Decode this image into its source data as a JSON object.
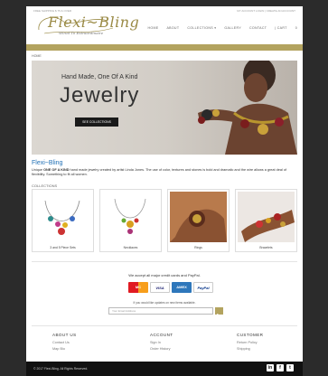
{
  "header": {
    "phone": "FREE SHIPPING $ 75 & OVER",
    "account_links": "MY ACCOUNT    LOGIN  |  CREATE AN ACCOUNT",
    "brand": "Flexi~Bling",
    "tagline": "Wired To Extraordinaire",
    "nav": [
      "HOME",
      "ABOUT",
      "COLLECTIONS ▾",
      "GALLERY",
      "CONTACT",
      "|  CART",
      "0"
    ]
  },
  "breadcrumb": "HOME",
  "hero": {
    "subtitle": "Hand Made, One Of A Kind",
    "title": "Jewelry",
    "button": "SEE COLLECTIONS"
  },
  "intro": {
    "title": "Flexi~Bling",
    "text_bold": "ONE OF A KIND",
    "text_pre": "Unique ",
    "text_post": " hand made jewelry created by artist Linda Jones. The use of color, textures and stones is bold and dramatic and the wire allows a great deal of flexibility. Something to fit all women."
  },
  "collections": {
    "label": "COLLECTIONS",
    "items": [
      "3 and 5 Piece Sets",
      "Necklaces",
      "Rings",
      "Bracelets"
    ]
  },
  "payment": {
    "text": "We accept all major credit cards and PayPal.",
    "cards": [
      "MC",
      "VISA",
      "AMEX",
      "PayPal"
    ]
  },
  "newsletter": {
    "text": "If you would like updates on new items available.",
    "placeholder": "Your Email Address"
  },
  "footer": {
    "columns": [
      {
        "title": "ABOUT US",
        "links": [
          "Contact Us",
          "Map Bio"
        ]
      },
      {
        "title": "ACCOUNT",
        "links": [
          "Sign In",
          "Order History"
        ]
      },
      {
        "title": "CUSTOMER",
        "links": [
          "Return Policy",
          "Shipping"
        ]
      }
    ],
    "copyright": "© 2017 Flexi-Bling. All Rights Reserved.",
    "social": [
      "in",
      "f",
      "t"
    ]
  },
  "colors": {
    "accent": "#b3a35f",
    "link": "#1f6fb5",
    "footer_bg": "#111111"
  }
}
